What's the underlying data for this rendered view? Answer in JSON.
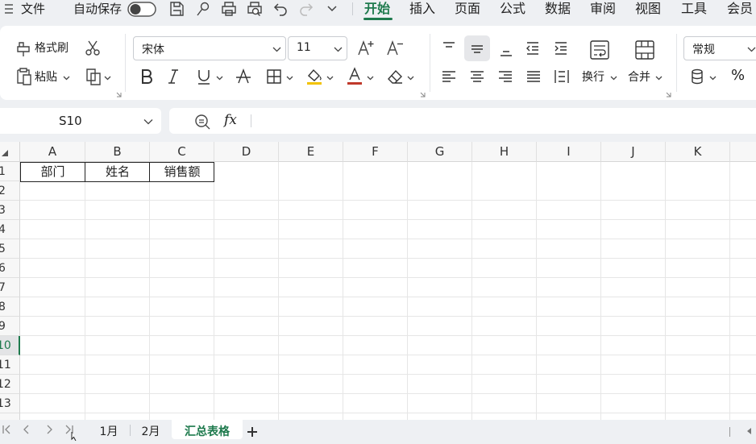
{
  "menubar": {
    "file_label": "文件",
    "autosave_label": "自动保存",
    "tabs": [
      "开始",
      "插入",
      "页面",
      "公式",
      "数据",
      "审阅",
      "视图",
      "工具",
      "会员"
    ]
  },
  "ribbon": {
    "format_painter": "格式刷",
    "paste": "粘贴",
    "font_name": "宋体",
    "font_size": "11",
    "wrap_text": "换行",
    "merge": "合并",
    "number_format": "常规",
    "percent_symbol": "%",
    "font_color_hex": "#c0392b",
    "fill_color_hex": "#f2c200"
  },
  "formula_bar": {
    "name_box": "S10",
    "fx_symbol": "fx",
    "content": ""
  },
  "grid": {
    "columns": [
      "A",
      "B",
      "C",
      "D",
      "E",
      "F",
      "G",
      "H",
      "I",
      "J",
      "K"
    ],
    "rows": [
      "1",
      "2",
      "3",
      "4",
      "5",
      "6",
      "7",
      "8",
      "9",
      "10",
      "11",
      "12",
      "13"
    ],
    "cells": {
      "A1": "部门",
      "B1": "姓名",
      "C1": "销售额"
    }
  },
  "sheets": {
    "tabs": [
      "1月",
      "2月",
      "汇总表格"
    ],
    "active": "汇总表格"
  },
  "colors": {
    "accent": "#1e7a4d"
  }
}
